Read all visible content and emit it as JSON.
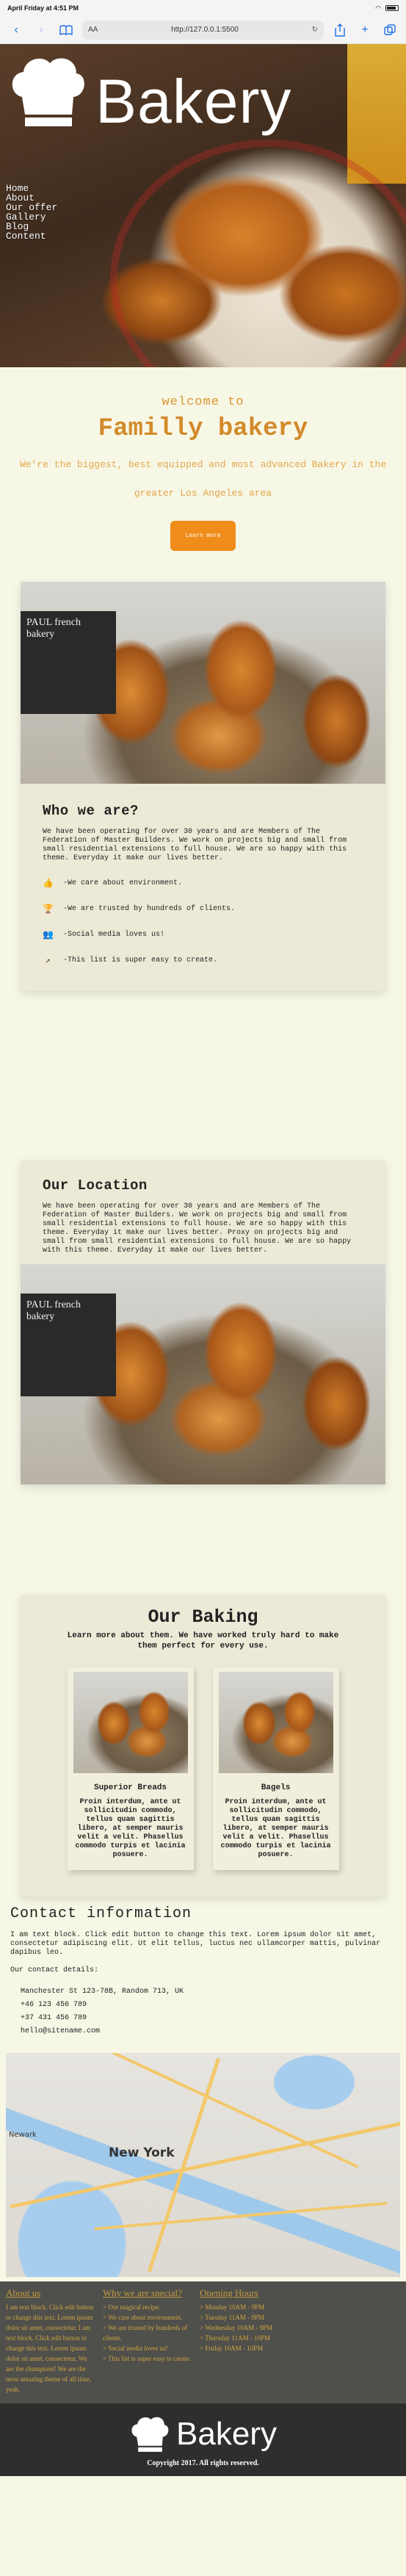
{
  "browser": {
    "status_time": "April Friday at 4:51 PM",
    "address_aa": "AA",
    "url": "http://127.0.0.1:5500"
  },
  "hero": {
    "logo_text": "Bakery",
    "nav": [
      "Home",
      "About",
      "Our offer",
      "Gallery",
      "Blog",
      "Content"
    ]
  },
  "welcome": {
    "sub": "welcome to",
    "title": "Familly bakery",
    "text": "We're the biggest, best equipped and most advanced Bakery in the greater Los Angeles area",
    "button": "Learn more"
  },
  "about": {
    "heading": "Who we are?",
    "photo_sign": "PAUL french bakery",
    "body": "We have been operating for over 30 years and are Members of The Federation of Master Builders. We work on projects big and small from small residential extensions to full house. We are so happy with this theme. Everyday it make our lives better.",
    "features": [
      {
        "icon": "thumbs-up-icon",
        "glyph": "👍",
        "text": "-We care about environment."
      },
      {
        "icon": "trophy-icon",
        "glyph": "🏆",
        "text": "-We are trusted by hundreds of clients."
      },
      {
        "icon": "users-icon",
        "glyph": "👥",
        "text": "-Social media loves us!"
      },
      {
        "icon": "trend-icon",
        "glyph": "↗",
        "text": "-This list is super easy to create."
      }
    ]
  },
  "location": {
    "heading": "Our Location",
    "body": "We have been operating for over 30 years and are Members of The Federation of Master Builders. We work on projects big and small from small residential extensions to full house. We are so happy with this theme. Everyday it make our lives better. Proxy on projects big and small from small residential extensions to full house. We are so happy with this theme. Everyday it make our lives better."
  },
  "baking": {
    "heading": "Our Baking",
    "lead": "Learn more about them. We have worked truly hard to make them perfect for every use.",
    "cards": [
      {
        "title": "Superior Breads",
        "text": "Proin interdum, ante ut sollicitudin commodo, tellus quam sagittis libero, at semper mauris velit a velit. Phasellus commodo turpis et lacinia posuere."
      },
      {
        "title": "Bagels",
        "text": "Proin interdum, ante ut sollicitudin commodo, tellus quam sagittis libero, at semper mauris velit a velit. Phasellus commodo turpis et lacinia posuere."
      }
    ]
  },
  "contact": {
    "heading": "Contact information",
    "text": "I am text block. Click edit button to change this text. Lorem ipsum dolor sit amet, consectetur adipiscing elit. Ut elit tellus, luctus nec ullamcorper mattis, pulvinar dapibus leo.",
    "details_label": "Our contact details:",
    "address": "Manchester St 123-78B, Random 713, UK",
    "phone1": "+46 123 456 789",
    "phone2": "+37 431 456 789",
    "email": "hello@sitename.com",
    "map_label_city": "New York",
    "map_label_nj": "Newark"
  },
  "footer": {
    "col1": {
      "title": "About us",
      "text": "I am text block. Click edit button to change this text. Lorem ipsum dolor sit amet, consectetur. I am text block. Click edit button to change this text. Lorem ipsum dolor sit amet, consectetur. We are the champions! We are the most amazing theme of all time, yeah."
    },
    "col2": {
      "title": "Why we are special?",
      "items": [
        "> Our magical recipe.",
        "> We care about environment.",
        "> We are trusted by hundreds of clients.",
        "> Social media loves us!",
        "> This list is super easy to create."
      ]
    },
    "col3": {
      "title": "Opening Hours",
      "items": [
        "> Monday 10AM - 9PM",
        "> Tuesday 11AM - 9PM",
        "> Wednesday 10AM - 9PM",
        "> Thursday 11AM - 10PM",
        "> Friday 10AM - 10PM"
      ]
    },
    "logo_text": "Bakery",
    "copyright": "Copyright 2017. All rights reserved."
  },
  "colors": {
    "accent": "#f08c1a",
    "heading_orange": "#d38a2a",
    "footer_dark": "#2e2e2c"
  }
}
